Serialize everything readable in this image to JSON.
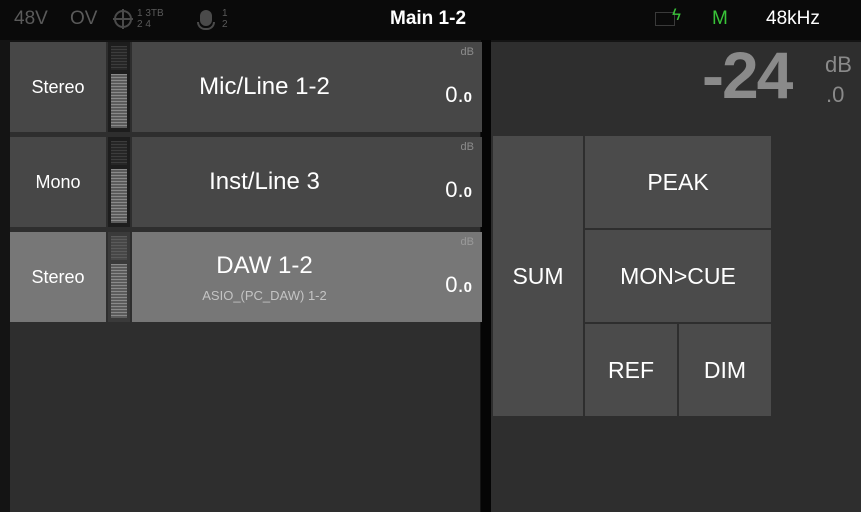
{
  "topbar": {
    "phantom": "48V",
    "overload": "OV",
    "phase_channels_top": "1 3TB",
    "phase_channels_bottom": "2 4",
    "mic_channels_top": "1",
    "mic_channels_bottom": "2",
    "title": "Main 1-2",
    "sync_icon": "clock-sync-icon",
    "mode": "M",
    "sample_rate": "48kHz"
  },
  "channels": [
    {
      "mode": "Stereo",
      "name": "Mic/Line 1-2",
      "subname": "",
      "gain_unit": "dB",
      "gain_int": "0.",
      "gain_dec": "0",
      "selected": false
    },
    {
      "mode": "Mono",
      "name": "Inst/Line 3",
      "subname": "",
      "gain_unit": "dB",
      "gain_int": "0.",
      "gain_dec": "0",
      "selected": false
    },
    {
      "mode": "Stereo",
      "name": "DAW 1-2",
      "subname": "ASIO_(PC_DAW) 1-2",
      "gain_unit": "dB",
      "gain_int": "0.",
      "gain_dec": "0",
      "selected": true
    }
  ],
  "monitor": {
    "level": "-24",
    "unit": "dB",
    "decimal": ".0"
  },
  "buttons": {
    "sum": "SUM",
    "peak": "PEAK",
    "mon_cue": "MON>CUE",
    "ref": "REF",
    "dim": "DIM"
  },
  "colors": {
    "status_green": "#39c439",
    "selected_row": "#777777",
    "row": "#474747"
  }
}
